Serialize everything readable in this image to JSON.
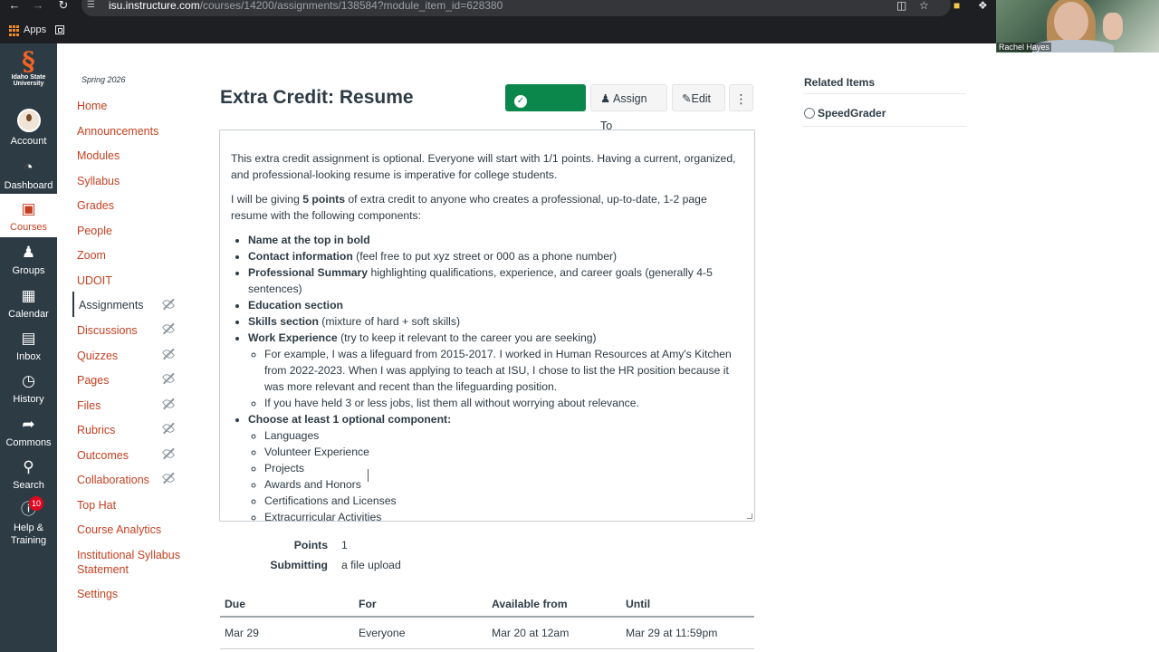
{
  "browser": {
    "url_host": "isu.instructure.com",
    "url_path": "/courses/14200/assignments/138584?module_item_id=628380",
    "bookmarks": {
      "apps_label": "Apps"
    }
  },
  "webcam": {
    "name": "Rachel Hayes"
  },
  "global_nav": {
    "logo_text": "Idaho State University",
    "items": [
      {
        "label": "Account"
      },
      {
        "label": "Dashboard"
      },
      {
        "label": "Courses"
      },
      {
        "label": "Groups"
      },
      {
        "label": "Calendar"
      },
      {
        "label": "Inbox"
      },
      {
        "label": "History"
      },
      {
        "label": "Commons"
      },
      {
        "label": "Search"
      },
      {
        "label": "Help & Training",
        "badge": "10"
      }
    ]
  },
  "course_nav": {
    "term": "Spring 2026",
    "links": [
      {
        "label": "Home"
      },
      {
        "label": "Announcements"
      },
      {
        "label": "Modules"
      },
      {
        "label": "Syllabus"
      },
      {
        "label": "Grades"
      },
      {
        "label": "People"
      },
      {
        "label": "Zoom"
      },
      {
        "label": "UDOIT"
      },
      {
        "label": "Assignments"
      },
      {
        "label": "Discussions"
      },
      {
        "label": "Quizzes"
      },
      {
        "label": "Pages"
      },
      {
        "label": "Files"
      },
      {
        "label": "Rubrics"
      },
      {
        "label": "Outcomes"
      },
      {
        "label": "Collaborations"
      },
      {
        "label": "Top Hat"
      },
      {
        "label": "Course Analytics"
      },
      {
        "label": "Institutional Syllabus Statement"
      },
      {
        "label": "Settings"
      }
    ]
  },
  "assignment": {
    "title": "Extra Credit: Resume",
    "buttons": {
      "published": "Published",
      "assign_to": "Assign To",
      "edit": "Edit"
    },
    "description": {
      "p1": "This extra credit assignment is optional. Everyone will start with 1/1 points. Having a current, organized, and professional-looking resume is imperative for college students.",
      "p2_before": "I will be giving ",
      "p2_bold": "5 points",
      "p2_after": " of extra credit to anyone who creates a professional, up-to-date, 1-2 page resume with the following components:",
      "items": [
        {
          "bold": "Name at the top in bold",
          "rest": ""
        },
        {
          "bold": "Contact information",
          "rest": " (feel free to put xyz street or 000 as a phone number)"
        },
        {
          "bold": "Professional Summary",
          "rest": " highlighting qualifications, experience, and career goals (generally 4-5 sentences)"
        },
        {
          "bold": "Education section",
          "rest": ""
        },
        {
          "bold": "Skills section",
          "rest": " (mixture of hard + soft skills)"
        },
        {
          "bold": "Work Experience",
          "rest": " (try to keep it relevant to the career you are seeking)"
        }
      ],
      "work_sub": [
        "For example, I was a lifeguard from 2015-2017. I worked in Human Resources at Amy's Kitchen from 2022-2023. When I was applying to teach at ISU, I chose to list the HR position because it was more relevant and recent than the lifeguarding position.",
        "If you have held 3 or less jobs, list them all without worrying about relevance."
      ],
      "optional_heading": "Choose at least 1 optional component:",
      "optional_items": [
        "Languages",
        "Volunteer Experience",
        "Projects",
        "Awards and Honors",
        "Certifications and Licenses",
        "Extracurricular Activities"
      ]
    },
    "details": {
      "points_label": "Points",
      "points_value": "1",
      "submitting_label": "Submitting",
      "submitting_value": "a file upload"
    },
    "dates_table": {
      "headers": [
        "Due",
        "For",
        "Available from",
        "Until"
      ],
      "rows": [
        [
          "Mar 29",
          "Everyone",
          "Mar 20 at 12am",
          "Mar 29 at 11:59pm"
        ]
      ]
    }
  },
  "sidebar": {
    "related_items_title": "Related Items",
    "speedgrader_label": "SpeedGrader"
  },
  "colors": {
    "global_nav_bg": "#2d3b45",
    "link": "#c54021",
    "published_green": "#0b874b",
    "text": "#2d3b45"
  },
  "icons": {
    "browser": [
      "back-arrow-icon",
      "forward-arrow-icon",
      "reload-icon",
      "site-settings-icon",
      "cast-icon",
      "star-icon",
      "folder-icon",
      "extension-icon",
      "apps-grid-icon",
      "tab-grid-icon"
    ],
    "global_nav": [
      "account-avatar",
      "dashboard-gauge-icon",
      "courses-book-icon",
      "groups-people-icon",
      "calendar-icon",
      "inbox-tray-icon",
      "history-clock-icon",
      "commons-arrow-icon",
      "search-magnifier-icon",
      "help-question-icon"
    ],
    "main": [
      "published-check-icon",
      "assign-person-icon",
      "edit-pencil-icon",
      "more-kebab-icon",
      "visibility-off-eye-icon",
      "speedgrader-icon",
      "resize-handle-icon"
    ]
  }
}
